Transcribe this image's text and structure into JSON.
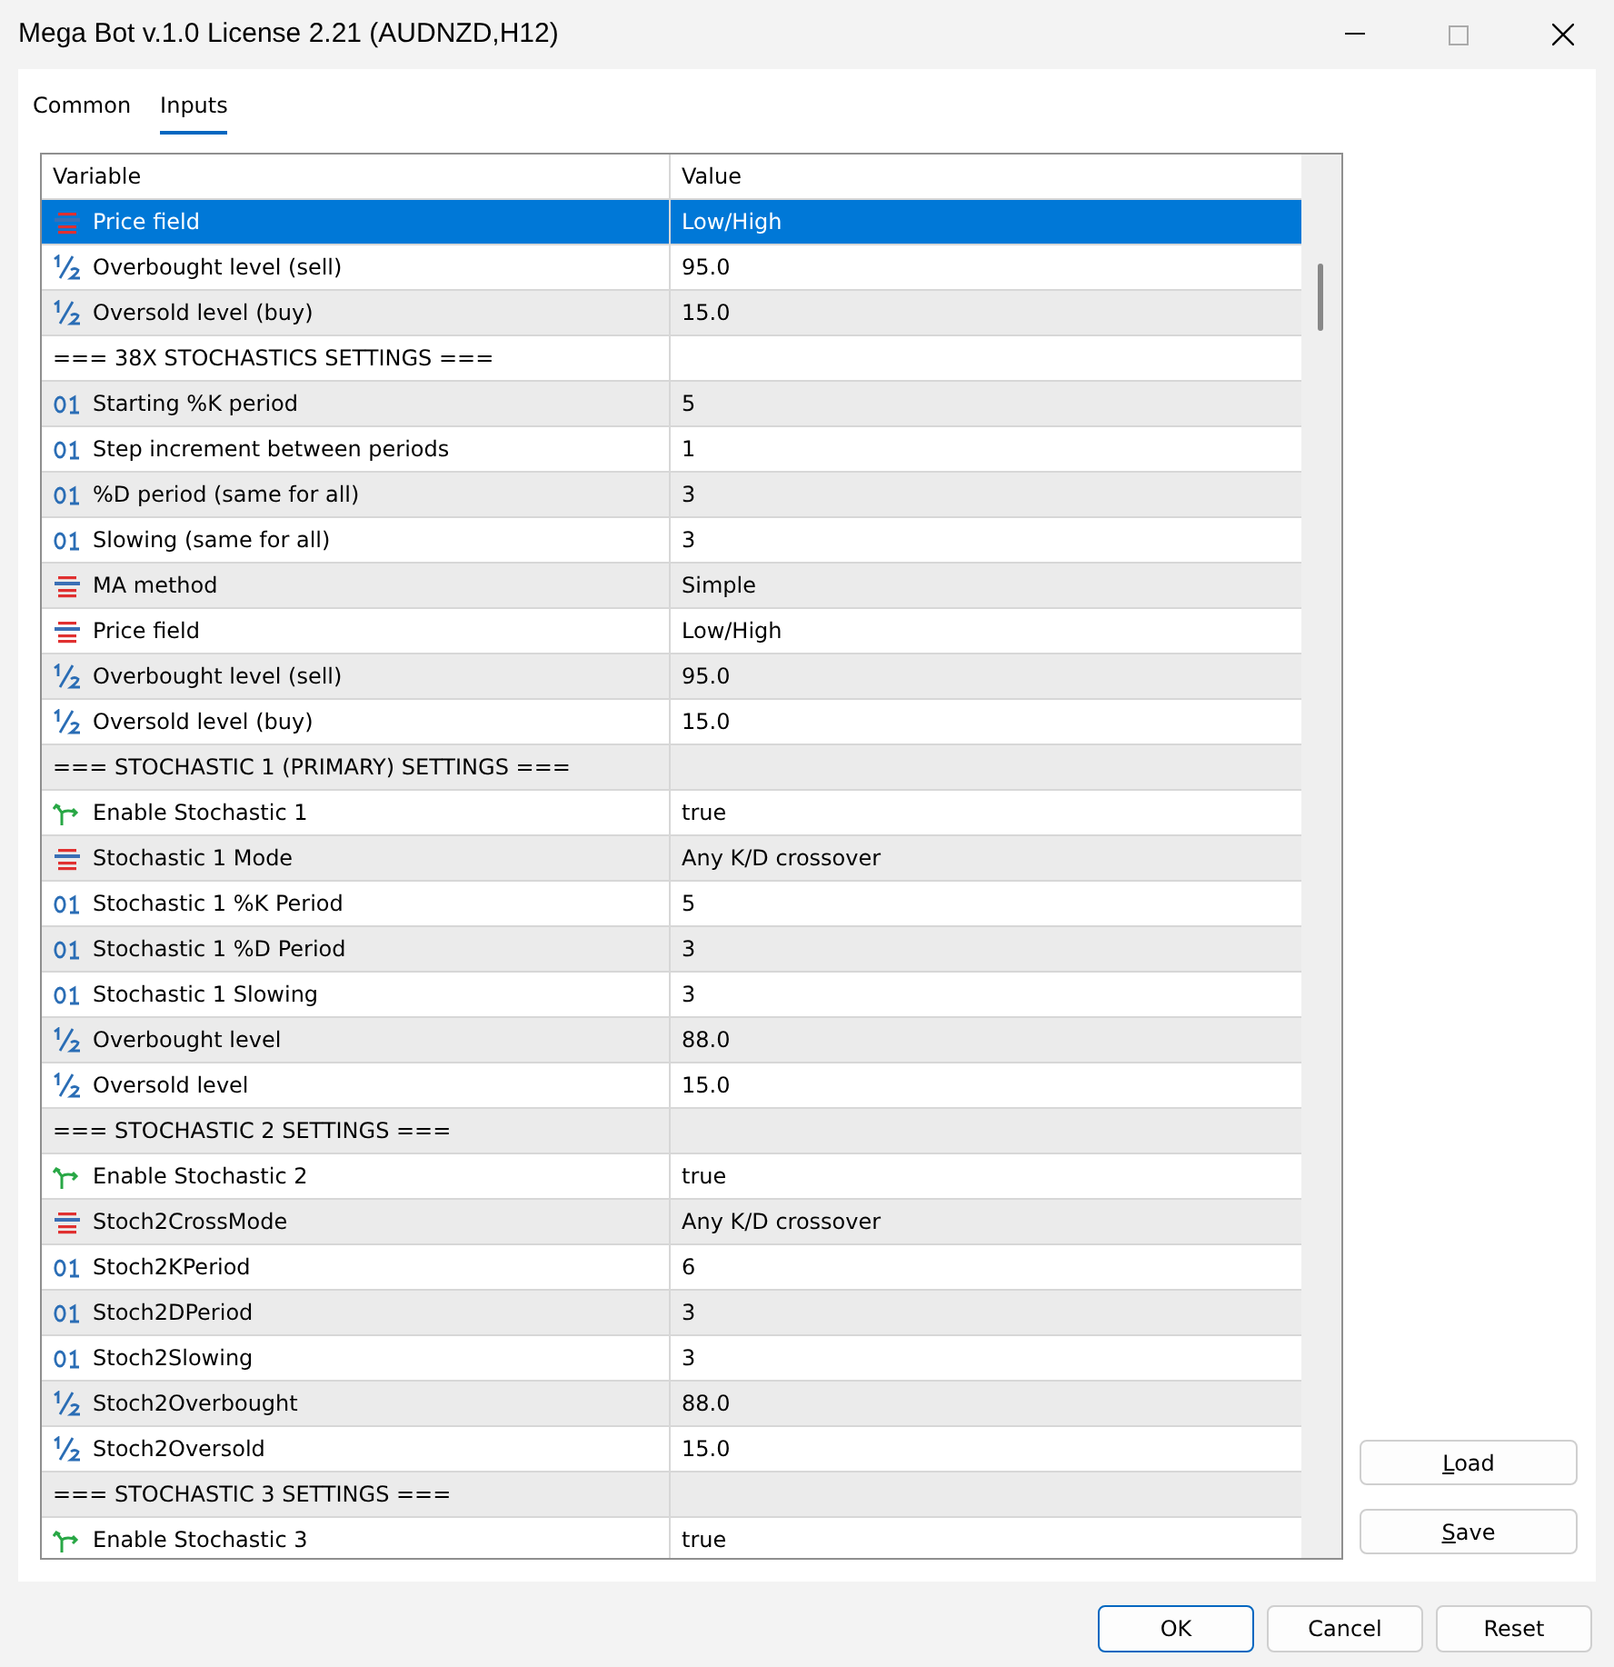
{
  "window": {
    "title": "Mega Bot v.1.0 License 2.21 (AUDNZD,H12)"
  },
  "tabs": [
    {
      "label": "Common",
      "selected": false
    },
    {
      "label": "Inputs",
      "selected": true
    }
  ],
  "table": {
    "columns": [
      "Variable",
      "Value"
    ],
    "rows": [
      {
        "kind": "enum",
        "variable": "Price field",
        "value": "Low/High",
        "selected": true
      },
      {
        "kind": "double",
        "variable": "Overbought level (sell)",
        "value": "95.0",
        "selected": false
      },
      {
        "kind": "double",
        "variable": "Oversold level (buy)",
        "value": "15.0",
        "selected": false
      },
      {
        "kind": "separator",
        "variable": "=== 38X STOCHASTICS SETTINGS ===",
        "value": "",
        "selected": false
      },
      {
        "kind": "int",
        "variable": "Starting %K period",
        "value": "5",
        "selected": false
      },
      {
        "kind": "int",
        "variable": "Step increment between periods",
        "value": "1",
        "selected": false
      },
      {
        "kind": "int",
        "variable": "%D period (same for all)",
        "value": "3",
        "selected": false
      },
      {
        "kind": "int",
        "variable": "Slowing (same for all)",
        "value": "3",
        "selected": false
      },
      {
        "kind": "enum",
        "variable": "MA method",
        "value": "Simple",
        "selected": false
      },
      {
        "kind": "enum",
        "variable": "Price field",
        "value": "Low/High",
        "selected": false
      },
      {
        "kind": "double",
        "variable": "Overbought level (sell)",
        "value": "95.0",
        "selected": false
      },
      {
        "kind": "double",
        "variable": "Oversold level (buy)",
        "value": "15.0",
        "selected": false
      },
      {
        "kind": "separator",
        "variable": "=== STOCHASTIC 1 (PRIMARY) SETTINGS ===",
        "value": "",
        "selected": false
      },
      {
        "kind": "bool",
        "variable": "Enable Stochastic 1",
        "value": "true",
        "selected": false
      },
      {
        "kind": "enum",
        "variable": "Stochastic 1 Mode",
        "value": "Any K/D crossover",
        "selected": false
      },
      {
        "kind": "int",
        "variable": "Stochastic 1 %K Period",
        "value": "5",
        "selected": false
      },
      {
        "kind": "int",
        "variable": "Stochastic 1 %D Period",
        "value": "3",
        "selected": false
      },
      {
        "kind": "int",
        "variable": "Stochastic 1 Slowing",
        "value": "3",
        "selected": false
      },
      {
        "kind": "double",
        "variable": "Overbought level",
        "value": "88.0",
        "selected": false
      },
      {
        "kind": "double",
        "variable": "Oversold level",
        "value": "15.0",
        "selected": false
      },
      {
        "kind": "separator",
        "variable": "=== STOCHASTIC 2 SETTINGS ===",
        "value": "",
        "selected": false
      },
      {
        "kind": "bool",
        "variable": "Enable Stochastic 2",
        "value": "true",
        "selected": false
      },
      {
        "kind": "enum",
        "variable": "Stoch2CrossMode",
        "value": "Any K/D crossover",
        "selected": false
      },
      {
        "kind": "int",
        "variable": "Stoch2KPeriod",
        "value": "6",
        "selected": false
      },
      {
        "kind": "int",
        "variable": "Stoch2DPeriod",
        "value": "3",
        "selected": false
      },
      {
        "kind": "int",
        "variable": "Stoch2Slowing",
        "value": "3",
        "selected": false
      },
      {
        "kind": "double",
        "variable": "Stoch2Overbought",
        "value": "88.0",
        "selected": false
      },
      {
        "kind": "double",
        "variable": "Stoch2Oversold",
        "value": "15.0",
        "selected": false
      },
      {
        "kind": "separator",
        "variable": "=== STOCHASTIC 3 SETTINGS ===",
        "value": "",
        "selected": false
      },
      {
        "kind": "bool",
        "variable": "Enable Stochastic 3",
        "value": "true",
        "selected": false
      }
    ]
  },
  "side_buttons": [
    "Load",
    "Save"
  ],
  "footer_buttons": [
    {
      "label": "OK",
      "default": true
    },
    {
      "label": "Cancel",
      "default": false
    },
    {
      "label": "Reset",
      "default": false
    }
  ]
}
